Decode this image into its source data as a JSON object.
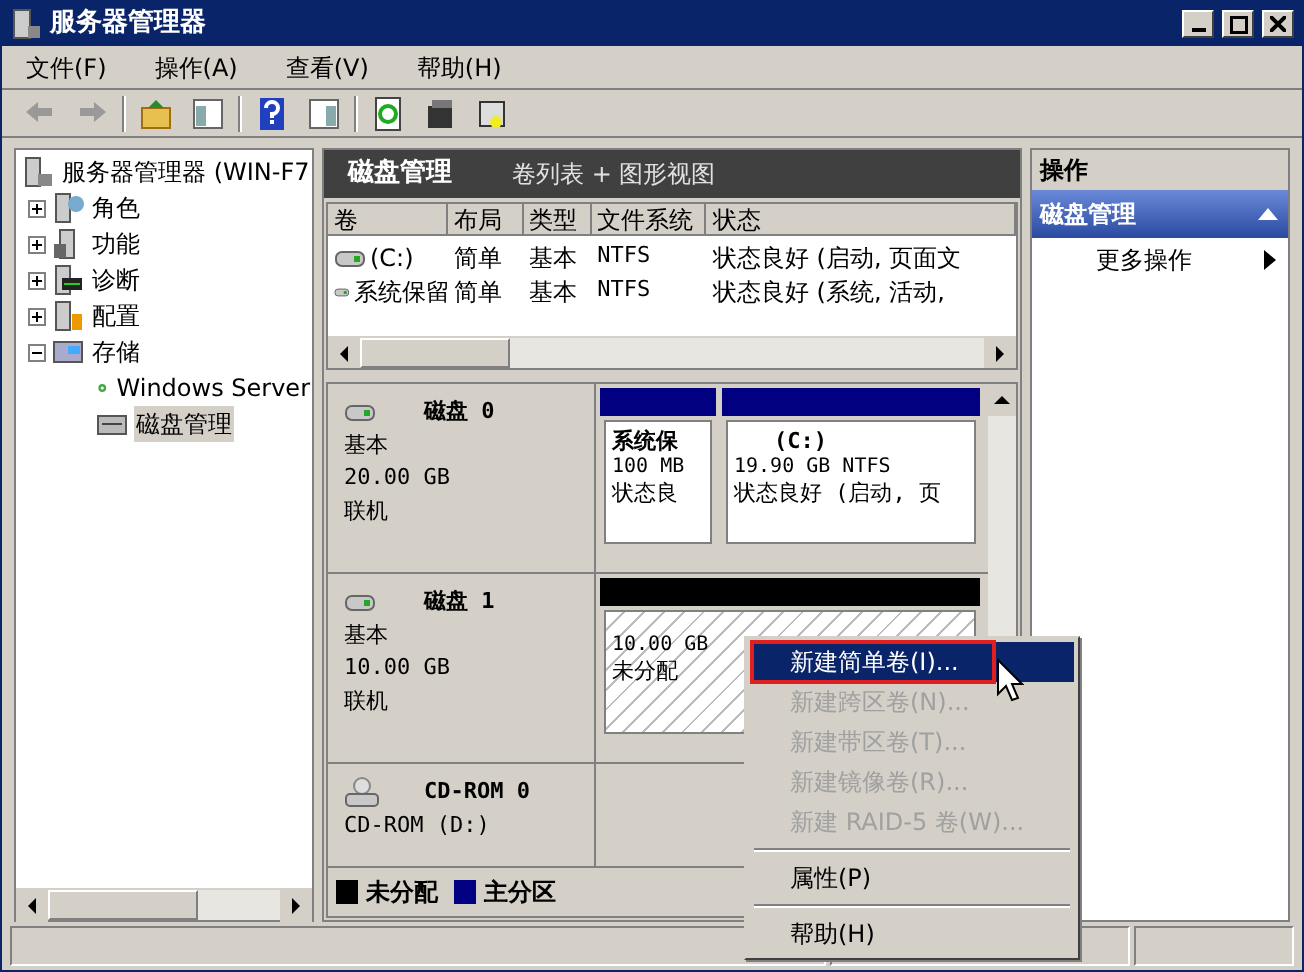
{
  "window": {
    "title": "服务器管理器"
  },
  "menu_bar": [
    "文件(F)",
    "操作(A)",
    "查看(V)",
    "帮助(H)"
  ],
  "tree": {
    "label": "服务器管理器 (WIN-F7",
    "children": [
      {
        "label": "角色",
        "expanded": false,
        "selected": false
      },
      {
        "label": "功能",
        "expanded": false,
        "selected": false
      },
      {
        "label": "诊断",
        "expanded": false,
        "selected": false
      },
      {
        "label": "配置",
        "expanded": false,
        "selected": false
      },
      {
        "label": "存储",
        "expanded": true,
        "selected": false,
        "children": [
          {
            "label": "Windows Server",
            "selected": false
          },
          {
            "label": "磁盘管理",
            "selected": true
          }
        ]
      }
    ]
  },
  "panel_header": {
    "title": "磁盘管理",
    "subtitle": "卷列表 + 图形视图"
  },
  "volume_table": {
    "columns": [
      "卷",
      "布局",
      "类型",
      "文件系统",
      "状态"
    ],
    "rows": [
      [
        "(C:)",
        "简单",
        "基本",
        "NTFS",
        "状态良好 (启动, 页面文"
      ],
      [
        "系统保留",
        "简单",
        "基本",
        "NTFS",
        "状态良好 (系统, 活动,"
      ]
    ]
  },
  "disks": [
    {
      "kind": "disk",
      "name": "磁盘 0",
      "type": "基本",
      "size": "20.00 GB",
      "status": "联机",
      "partitions": [
        {
          "kind": "primary",
          "name": "系统保",
          "detail": "100 MB",
          "status": "状态良"
        },
        {
          "kind": "primary",
          "name": "(C:)",
          "detail": "19.90 GB NTFS",
          "status": "状态良好 (启动, 页"
        }
      ]
    },
    {
      "kind": "disk",
      "name": "磁盘 1",
      "type": "基本",
      "size": "10.00 GB",
      "status": "联机",
      "partitions": [
        {
          "kind": "unallocated",
          "detail": "10.00 GB",
          "status": "未分配"
        }
      ]
    },
    {
      "kind": "cdrom",
      "name": "CD-ROM 0",
      "type": "CD-ROM (D:)"
    }
  ],
  "legend": [
    {
      "label": "未分配",
      "color": "#000000"
    },
    {
      "label": "主分区",
      "color": "#000080"
    }
  ],
  "actions": {
    "title": "操作",
    "section": "磁盘管理",
    "items": [
      "更多操作"
    ]
  },
  "context_menu": [
    [
      {
        "label": "新建简单卷(I)...",
        "selected": true,
        "disabled": false,
        "annotated": true
      },
      {
        "label": "新建跨区卷(N)...",
        "selected": false,
        "disabled": true,
        "annotated": false
      },
      {
        "label": "新建带区卷(T)...",
        "selected": false,
        "disabled": true,
        "annotated": false
      },
      {
        "label": "新建镜像卷(R)...",
        "selected": false,
        "disabled": true,
        "annotated": false
      },
      {
        "label": "新建 RAID-5 卷(W)...",
        "selected": false,
        "disabled": true,
        "annotated": false
      }
    ],
    [
      {
        "label": "属性(P)",
        "selected": false,
        "disabled": false,
        "annotated": false
      }
    ],
    [
      {
        "label": "帮助(H)",
        "selected": false,
        "disabled": false,
        "annotated": false
      }
    ]
  ]
}
